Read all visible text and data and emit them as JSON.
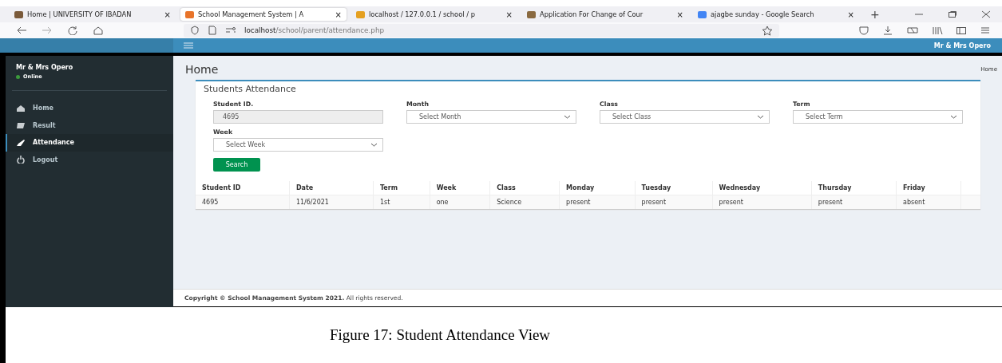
{
  "browser": {
    "tabs": [
      {
        "title": "Home | UNIVERSITY OF IBADAN",
        "close": "×",
        "selected": false
      },
      {
        "title": "School Management System | A",
        "close": "×",
        "selected": true
      },
      {
        "title": "localhost / 127.0.0.1 / school / p",
        "close": "×",
        "selected": false
      },
      {
        "title": "Application For Change of Cour",
        "close": "×",
        "selected": false
      },
      {
        "title": "ajagbe sunday - Google Search",
        "close": "×",
        "selected": false
      }
    ],
    "new_tab": "+",
    "url_host": "localhost",
    "url_path": "/school/parent/attendance.php"
  },
  "header": {
    "user": "Mr & Mrs Opero"
  },
  "sidebar": {
    "user": "Mr & Mrs Opero",
    "status": "Online",
    "items": [
      {
        "label": "Home",
        "kind": "home",
        "selected": false
      },
      {
        "label": "Result",
        "kind": "result",
        "selected": false
      },
      {
        "label": "Attendance",
        "kind": "attendance",
        "selected": true
      },
      {
        "label": "Logout",
        "kind": "logout",
        "selected": false
      }
    ]
  },
  "page": {
    "title": "Home",
    "breadcrumb": "Home"
  },
  "card": {
    "title": "Students Attendance",
    "fields": [
      {
        "label": "Student ID.",
        "kind": "text",
        "value": "4695"
      },
      {
        "label": "Month",
        "kind": "select",
        "placeholder": "Select Month"
      },
      {
        "label": "Class",
        "kind": "select",
        "placeholder": "Select Class"
      },
      {
        "label": "Term",
        "kind": "select",
        "placeholder": "Select Term"
      },
      {
        "label": "Week",
        "kind": "select",
        "placeholder": "Select Week"
      }
    ],
    "button": "Search"
  },
  "table": {
    "columns": [
      "Student ID",
      "Date",
      "Term",
      "Week",
      "Class",
      "Monday",
      "Tuesday",
      "Wednesday",
      "Thursday",
      "Friday"
    ],
    "rows": [
      [
        "4695",
        "11/6/2021",
        "1st",
        "one",
        "Science",
        "present",
        "present",
        "present",
        "present",
        "absent"
      ]
    ]
  },
  "footer": "**Copyright © School Management System 2021.** All rights reserved.",
  "caption": "Figure 17: Student Attendance View"
}
